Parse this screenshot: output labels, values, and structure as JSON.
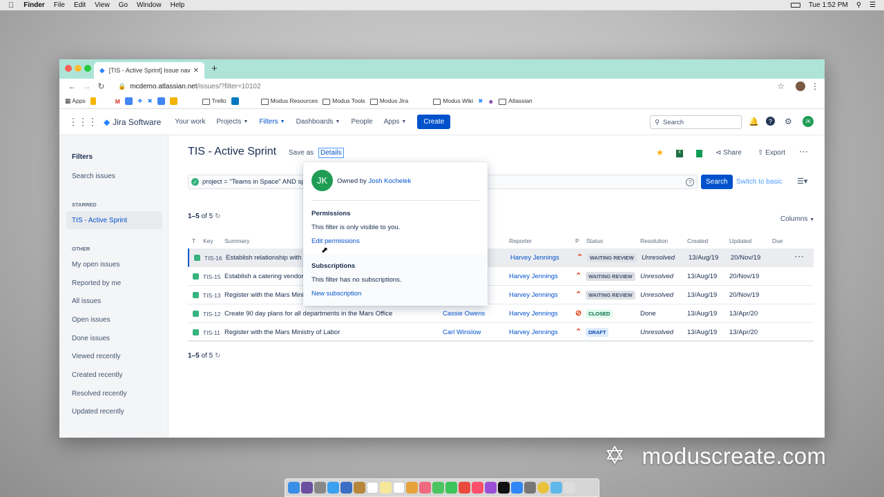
{
  "menubar": {
    "apple": "",
    "items": [
      "Finder",
      "File",
      "Edit",
      "View",
      "Go",
      "Window",
      "Help"
    ],
    "clock": "Tue 1:52 PM"
  },
  "browser": {
    "tab_title": "[TIS - Active Sprint] Issue navigator",
    "url_host": "mcdemo.atlassian.net",
    "url_path": "/issues/?filter=10102",
    "bookmarks": {
      "apps": "Apps",
      "modus_resources": "Modus Resources",
      "modus_tools": "Modus Tools",
      "modus_jira": "Modus Jira",
      "trello": "Trello",
      "modus_wiki": "Modus Wiki",
      "atlassian": "Atlassian"
    }
  },
  "jira_nav": {
    "product": "Jira Software",
    "your_work": "Your work",
    "projects": "Projects",
    "filters": "Filters",
    "dashboards": "Dashboards",
    "people": "People",
    "apps": "Apps",
    "create": "Create",
    "search_placeholder": "Search",
    "avatar": "JK"
  },
  "sidebar": {
    "title": "Filters",
    "search_issues": "Search issues",
    "starred_caption": "STARRED",
    "starred_item": "TIS - Active Sprint",
    "other_caption": "OTHER",
    "other": [
      "My open issues",
      "Reported by me",
      "All issues",
      "Open issues",
      "Done issues",
      "Viewed recently",
      "Created recently",
      "Resolved recently",
      "Updated recently"
    ]
  },
  "page": {
    "title": "TIS - Active Sprint",
    "save_as": "Save as",
    "details": "Details",
    "share": "Share",
    "export": "Export",
    "jql": "project = \"Teams in Space\" AND spri",
    "search_button": "Search",
    "switch_basic": "Switch to basic",
    "count_prefix": "1–5",
    "count_suffix": "of 5",
    "columns": "Columns"
  },
  "table": {
    "headers": {
      "t": "T",
      "key": "Key",
      "summary": "Summary",
      "reporter": "Reporter",
      "p": "P",
      "status": "Status",
      "resolution": "Resolution",
      "created": "Created",
      "updated": "Updated",
      "due": "Due"
    },
    "rows": [
      {
        "key": "TIS-16",
        "summary": "Establish relationship with lo",
        "assignee": "",
        "reporter": "Harvey Jennings",
        "status": "WAITING REVIEW",
        "resolution": "Unresolved",
        "created": "13/Aug/19",
        "updated": "20/Nov/19"
      },
      {
        "key": "TIS-15",
        "summary": "Establish a catering vendor t",
        "assignee": "s",
        "reporter": "Harvey Jennings",
        "status": "WAITING REVIEW",
        "resolution": "Unresolved",
        "created": "13/Aug/19",
        "updated": "20/Nov/19"
      },
      {
        "key": "TIS-13",
        "summary": "Register with the Mars Minis",
        "assignee": "",
        "reporter": "Harvey Jennings",
        "status": "WAITING REVIEW",
        "resolution": "Unresolved",
        "created": "13/Aug/19",
        "updated": "20/Nov/19"
      },
      {
        "key": "TIS-12",
        "summary": "Create 90 day plans for all departments in the Mars Office",
        "assignee": "Cassie Owens",
        "reporter": "Harvey Jennings",
        "status": "CLOSED",
        "resolution": "Done",
        "created": "13/Aug/19",
        "updated": "13/Apr/20"
      },
      {
        "key": "TIS-11",
        "summary": "Register with the Mars Ministry of Labor",
        "assignee": "Carl Winslow",
        "reporter": "Harvey Jennings",
        "status": "DRAFT",
        "resolution": "Unresolved",
        "created": "13/Aug/19",
        "updated": "13/Apr/20"
      }
    ]
  },
  "popover": {
    "avatar": "JK",
    "owned_by": "Owned by",
    "owner": "Josh Kochelek",
    "permissions_title": "Permissions",
    "permissions_text": "This filter is only visible to you.",
    "edit_permissions": "Edit permissions",
    "subscriptions_title": "Subscriptions",
    "subscriptions_text": "This filter has no subscriptions.",
    "new_subscription": "New subscription"
  },
  "watermark": "moduscreate.com"
}
